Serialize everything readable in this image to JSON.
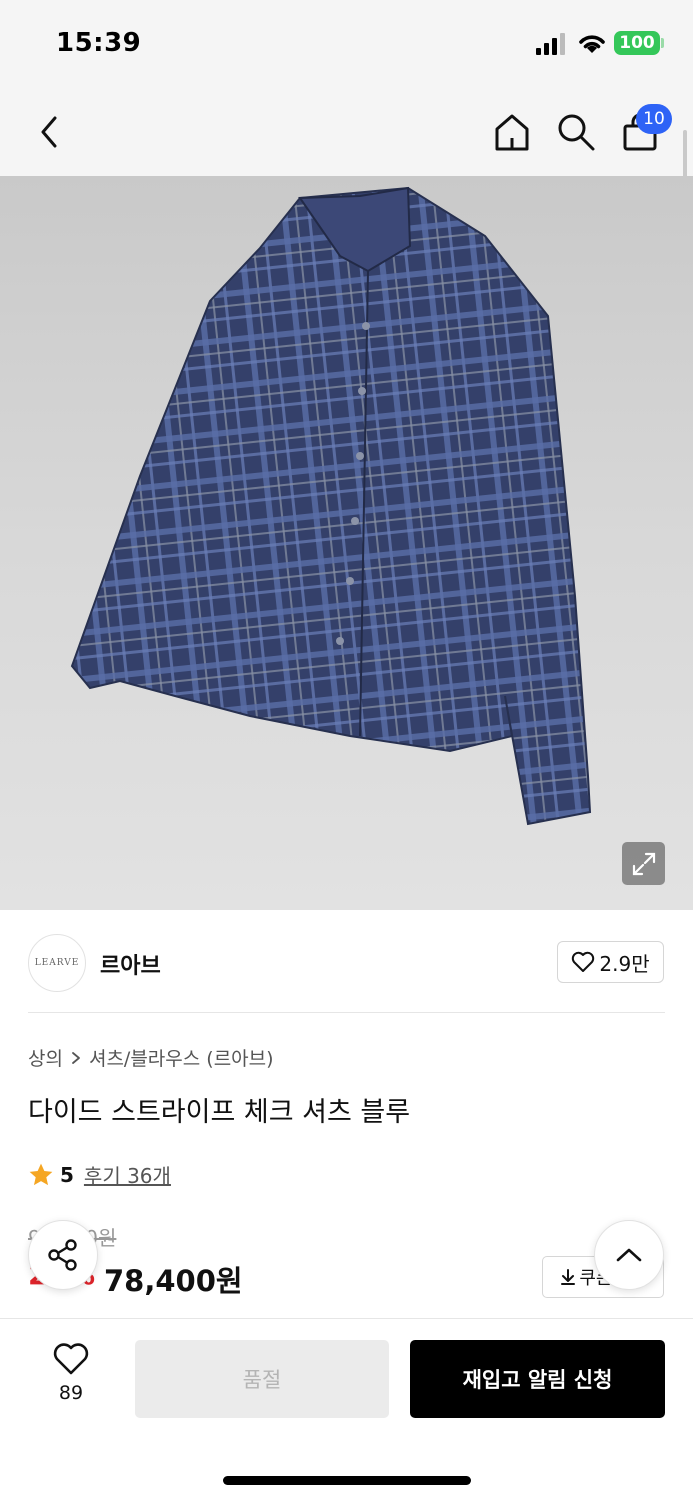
{
  "status_bar": {
    "time": "15:39",
    "battery": "100"
  },
  "nav": {
    "back_icon": "chevron-left-icon",
    "home_icon": "home-icon",
    "search_icon": "search-icon",
    "cart_icon": "shopping-bag-icon",
    "cart_count": "10"
  },
  "product_image": {
    "subject": "blue plaid long-sleeve shirt",
    "expand_icon": "expand-icon"
  },
  "brand": {
    "logo_text": "LEARVE",
    "name": "르아브",
    "likes": "2.9만"
  },
  "breadcrumb": {
    "category": "상의",
    "subcategory": "셔츠/블라우스 (르아브)"
  },
  "product": {
    "title": "다이드 스트라이프 체크 셔츠 블루",
    "rating": "5",
    "review_label": "후기 36개",
    "original_price": "98,000원",
    "discount": "20%",
    "sale_price": "78,400원",
    "coupon_label": "쿠폰받기"
  },
  "bottom_bar": {
    "wish_count": "89",
    "soldout_label": "품절",
    "restock_label": "재입고 알림 신청"
  },
  "colors": {
    "accent_blue": "#2e63f6",
    "discount_red": "#e0242b",
    "battery_green": "#34c759",
    "star": "#f5a623"
  }
}
